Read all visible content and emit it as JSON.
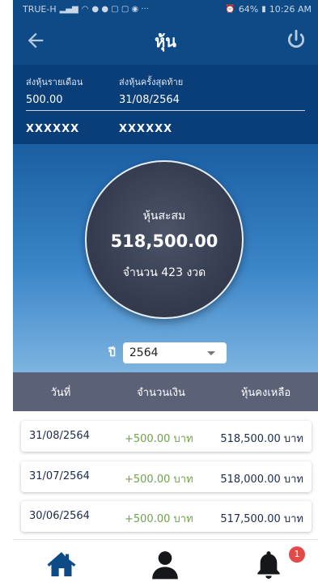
{
  "status_bar": {
    "carrier": "TRUE-H",
    "battery": "64%",
    "time": "10:26 AM"
  },
  "header": {
    "title": "หุ้น"
  },
  "summary": {
    "monthly_label": "ส่งหุ้นรายเดือน",
    "monthly_value": "500.00",
    "last_label": "ส่งหุ้นครั้งสุดท้าย",
    "last_value": "31/08/2564",
    "mask_left": "XXXXXX",
    "mask_right": "XXXXXX"
  },
  "hero": {
    "title": "หุ้นสะสม",
    "amount": "518,500.00",
    "count": "จำนวน 423 งวด",
    "year_label": "ปี",
    "year_value": "2564"
  },
  "table": {
    "headers": [
      "วันที่",
      "จำนวนเงิน",
      "หุ้นคงเหลือ"
    ],
    "rows": [
      {
        "date": "31/08/2564",
        "amount": "+500.00 บาท",
        "balance": "518,500.00 บาท"
      },
      {
        "date": "31/07/2564",
        "amount": "+500.00 บาท",
        "balance": "518,000.00 บาท"
      },
      {
        "date": "30/06/2564",
        "amount": "+500.00 บาท",
        "balance": "517,500.00 บาท"
      }
    ]
  },
  "nav": {
    "icons": [
      "home-icon",
      "user-icon",
      "bell-icon"
    ],
    "notification_count": "1"
  },
  "colors": {
    "primary": "#0d4a86",
    "amount_green": "#6fa24a",
    "table_header": "#5b6278",
    "badge": "#e24a4a"
  }
}
